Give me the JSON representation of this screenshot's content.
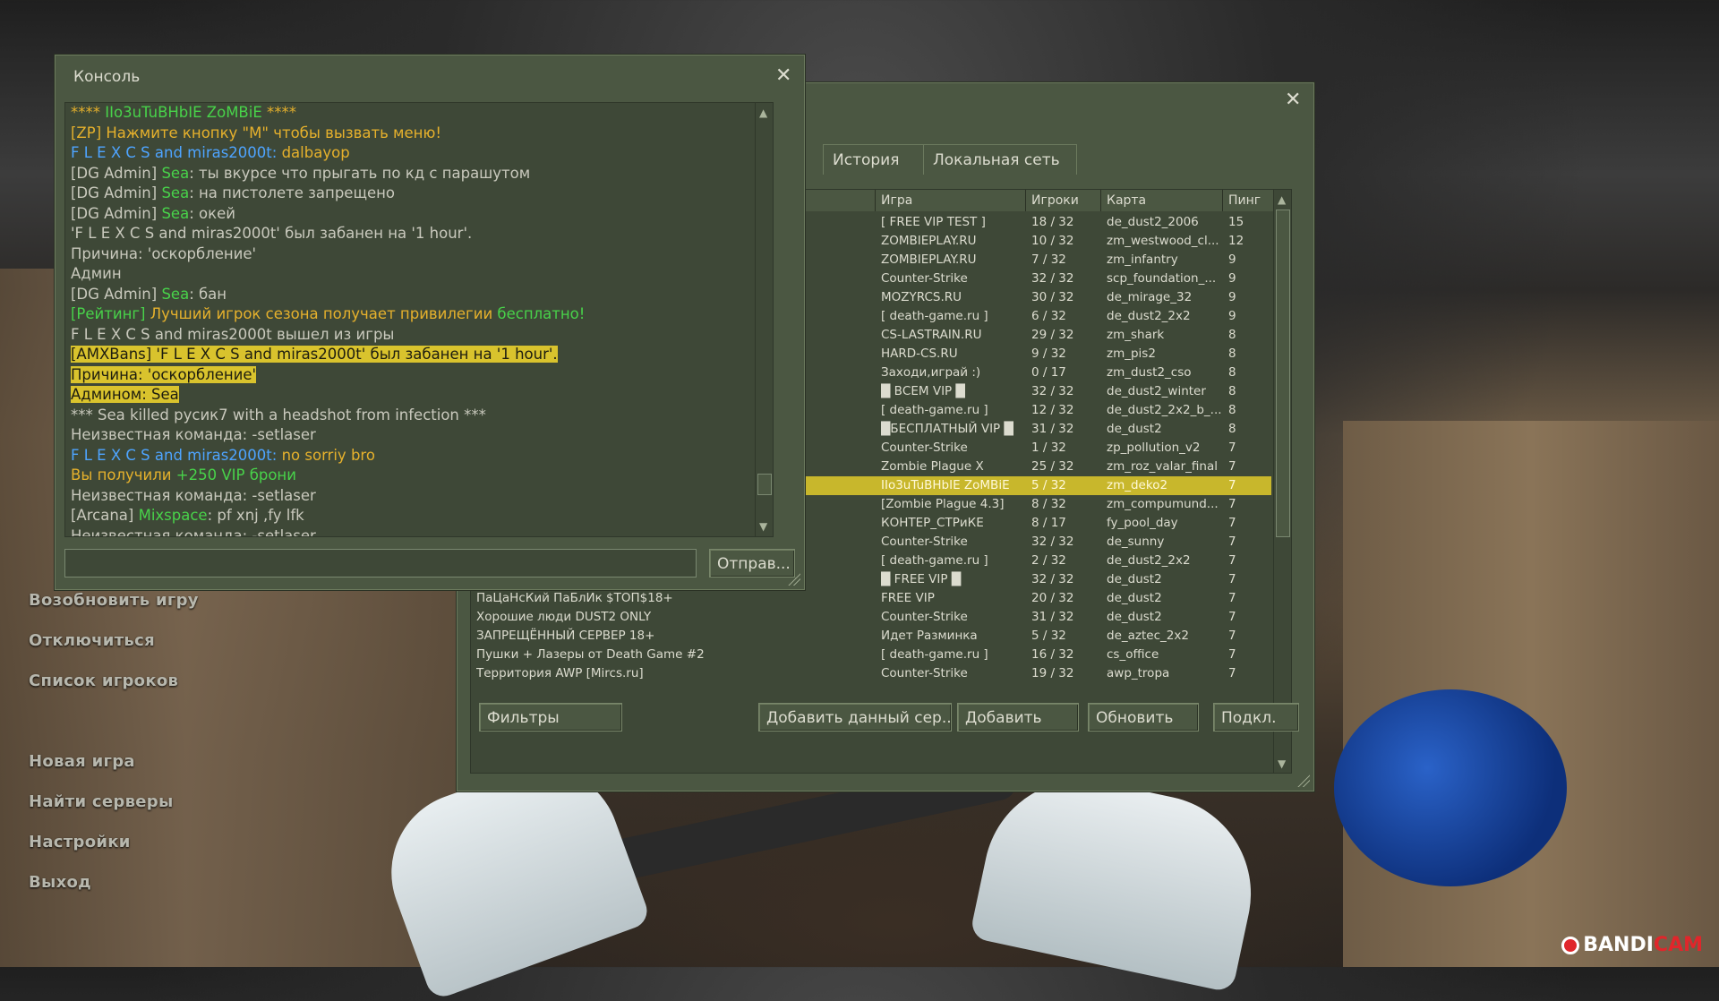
{
  "main_menu": {
    "items": [
      "Возобновить игру",
      "Отключиться",
      "Список игроков",
      "Новая игра",
      "Найти серверы",
      "Настройки",
      "Выход"
    ]
  },
  "console": {
    "title": "Консоль",
    "send_label": "Отправ...",
    "input_value": "",
    "lines": [
      {
        "parts": [
          {
            "t": "**** ",
            "c": "yellow"
          },
          {
            "t": "IIo3uTuBHbIE ZoMBiE",
            "c": "green"
          },
          {
            "t": " ****",
            "c": "yellow"
          }
        ]
      },
      {
        "parts": [
          {
            "t": "[ZP] Нажмите кнопку \"M\" чтобы вызвать меню!",
            "c": "yellow"
          }
        ]
      },
      {
        "parts": [
          {
            "t": "F  L  E  X  C  S and miras2000t: ",
            "c": "blue"
          },
          {
            "t": "dalbayop",
            "c": "yellow"
          }
        ]
      },
      {
        "parts": [
          {
            "t": "[DG Admin] ",
            "c": "gray"
          },
          {
            "t": "Sea",
            "c": "green"
          },
          {
            "t": ": ты вкурсе что прыгать по кд с парашутом",
            "c": "gray"
          }
        ]
      },
      {
        "parts": [
          {
            "t": "[DG Admin] ",
            "c": "gray"
          },
          {
            "t": "Sea",
            "c": "green"
          },
          {
            "t": ": на пистолете запрещено",
            "c": "gray"
          }
        ]
      },
      {
        "parts": [
          {
            "t": "[DG Admin] ",
            "c": "gray"
          },
          {
            "t": "Sea",
            "c": "green"
          },
          {
            "t": ": окей",
            "c": "gray"
          }
        ]
      },
      {
        "parts": [
          {
            "t": "'F  L  E  X  C  S and miras2000t' был забанен на '1 hour'.",
            "c": "gray"
          }
        ]
      },
      {
        "parts": [
          {
            "t": " Причина: 'оскорбление'",
            "c": "gray"
          }
        ]
      },
      {
        "parts": [
          {
            "t": " Админ",
            "c": "gray"
          }
        ]
      },
      {
        "parts": [
          {
            "t": "[DG Admin] ",
            "c": "gray"
          },
          {
            "t": "Sea",
            "c": "green"
          },
          {
            "t": ": бан",
            "c": "gray"
          }
        ]
      },
      {
        "parts": [
          {
            "t": "[Рейтинг] ",
            "c": "green"
          },
          {
            "t": "Лучший игрок сезона получает привилегии ",
            "c": "yellow"
          },
          {
            "t": "бесплатно!",
            "c": "green"
          }
        ]
      },
      {
        "parts": [
          {
            "t": "F  L  E  X  C  S and miras2000t вышел из игры",
            "c": "gray"
          }
        ]
      },
      {
        "parts": [
          {
            "t": "[AMXBans] 'F  L  E  X  C  S and miras2000t' был забанен на '1 hour'.",
            "c": "hl"
          }
        ]
      },
      {
        "parts": [
          {
            "t": " Причина: 'оскорбление'",
            "c": "hl"
          }
        ]
      },
      {
        "parts": [
          {
            "t": " Админом: Sea",
            "c": "hl"
          }
        ]
      },
      {
        "parts": [
          {
            "t": "*** Sea killed русик7 with a headshot from infection ***",
            "c": "gray"
          }
        ]
      },
      {
        "parts": [
          {
            "t": "Неизвестная команда: -setlaser",
            "c": "gray"
          }
        ]
      },
      {
        "parts": [
          {
            "t": "F  L  E  X  C  S and miras2000t: ",
            "c": "blue"
          },
          {
            "t": "no sorriy bro",
            "c": "yellow"
          }
        ]
      },
      {
        "parts": [
          {
            "t": "Вы получили ",
            "c": "yellow"
          },
          {
            "t": "+250 VIP брони",
            "c": "green"
          }
        ]
      },
      {
        "parts": [
          {
            "t": "Неизвестная команда: -setlaser",
            "c": "gray"
          }
        ]
      },
      {
        "parts": [
          {
            "t": "[Arcana] ",
            "c": "gray"
          },
          {
            "t": "Mixspace",
            "c": "green"
          },
          {
            "t": ": pf xnj ,fy lfk",
            "c": "gray"
          }
        ]
      },
      {
        "parts": [
          {
            "t": "Неизвестная команда: -setlaser",
            "c": "gray"
          }
        ]
      }
    ]
  },
  "servers": {
    "tabs": [
      "История",
      "Локальная сеть"
    ],
    "columns": [
      "Игра",
      "Игроки",
      "Карта",
      "Пинг"
    ],
    "rows": [
      {
        "name": "",
        "game": "[ FREE VIP TEST ]",
        "players": "18 / 32",
        "map": "de_dust2_2006",
        "ping": "15"
      },
      {
        "name": "",
        "game": "ZOMBIEPLAY.RU",
        "players": "10 / 32",
        "map": "zm_westwood_cl...",
        "ping": "12"
      },
      {
        "name": "",
        "game": "ZOMBIEPLAY.RU",
        "players": "7 / 32",
        "map": "zm_infantry",
        "ping": "9"
      },
      {
        "name": "",
        "game": "Counter-Strike",
        "players": "32 / 32",
        "map": "scp_foundation_...",
        "ping": "9"
      },
      {
        "name": "",
        "game": "MOZYRCS.RU",
        "players": "30 / 32",
        "map": "de_mirage_32",
        "ping": "9"
      },
      {
        "name": "",
        "game": "[ death-game.ru ]",
        "players": "6 / 32",
        "map": "de_dust2_2x2",
        "ping": "9"
      },
      {
        "name": "",
        "game": "CS-LASTRAIN.RU",
        "players": "29 / 32",
        "map": "zm_shark",
        "ping": "8"
      },
      {
        "name": "",
        "game": "HARD-CS.RU",
        "players": "9 / 32",
        "map": "zm_pis2",
        "ping": "8"
      },
      {
        "name": "",
        "game": "Заходи,играй :)",
        "players": "0 / 17",
        "map": "zm_dust2_cso",
        "ping": "8"
      },
      {
        "name": "",
        "game": "█ ВСЕМ VIP █",
        "players": "32 / 32",
        "map": "de_dust2_winter",
        "ping": "8"
      },
      {
        "name": "",
        "game": "[ death-game.ru ]",
        "players": "12 / 32",
        "map": "de_dust2_2x2_b_...",
        "ping": "8"
      },
      {
        "name": "",
        "game": "█БЕСПЛАТНЫЙ VIP █",
        "players": "31 / 32",
        "map": "de_dust2",
        "ping": "8"
      },
      {
        "name": "",
        "game": "Counter-Strike",
        "players": "1 / 32",
        "map": "zp_pollution_v2",
        "ping": "7"
      },
      {
        "name": "",
        "game": "Zombie Plague X",
        "players": "25 / 32",
        "map": "zm_roz_valar_final",
        "ping": "7"
      },
      {
        "name": "",
        "game": "IIo3uTuBHbIE ZoMBiE",
        "players": "5 / 32",
        "map": "zm_deko2",
        "ping": "7",
        "selected": true
      },
      {
        "name": "",
        "game": "[Zombie Plague 4.3]",
        "players": "8 / 32",
        "map": "zm_compumund...",
        "ping": "7"
      },
      {
        "name": "",
        "game": "КОНТЕР_СТРиКЕ",
        "players": "8 / 17",
        "map": "fy_pool_day",
        "ping": "7"
      },
      {
        "name": "",
        "game": "Counter-Strike",
        "players": "32 / 32",
        "map": "de_sunny",
        "ping": "7"
      },
      {
        "name": "",
        "game": "[ death-game.ru ]",
        "players": "2 / 32",
        "map": "de_dust2_2x2",
        "ping": "7"
      },
      {
        "name": "",
        "game": "█   FREE  VIP   █",
        "players": "32 / 32",
        "map": "de_dust2",
        "ping": "7"
      },
      {
        "name": "ПаЦаНсКий ПаБлИк $ТОП$18+",
        "game": "FREE VIP",
        "players": "20 / 32",
        "map": "de_dust2",
        "ping": "7"
      },
      {
        "name": "Хорошие люди DUST2 ONLY",
        "game": "Counter-Strike",
        "players": "31 / 32",
        "map": "de_dust2",
        "ping": "7"
      },
      {
        "name": "ЗАПРЕЩЁННЫЙ СЕРВЕР 18+",
        "game": "Идет Разминка",
        "players": "5 / 32",
        "map": "de_aztec_2x2",
        "ping": "7"
      },
      {
        "name": "Пушки + Лазеры от Death Game #2",
        "game": "[ death-game.ru ]",
        "players": "16 / 32",
        "map": "cs_office",
        "ping": "7"
      },
      {
        "name": "Территория AWP [Mircs.ru]",
        "game": "Counter-Strike",
        "players": "19 / 32",
        "map": "awp_tropa",
        "ping": "7"
      }
    ],
    "buttons": {
      "filters": "Фильтры",
      "add_current": "Добавить данный сер...",
      "add": "Добавить",
      "refresh": "Обновить",
      "connect": "Подкл."
    }
  },
  "watermark": {
    "brand_a": "BANDI",
    "brand_b": "CAM"
  },
  "colors": {
    "panel": "#4b5742",
    "highlight": "#d9c32d",
    "yellow_text": "#e6b12c",
    "green_text": "#48d24a",
    "blue_text": "#4ea4ff"
  }
}
